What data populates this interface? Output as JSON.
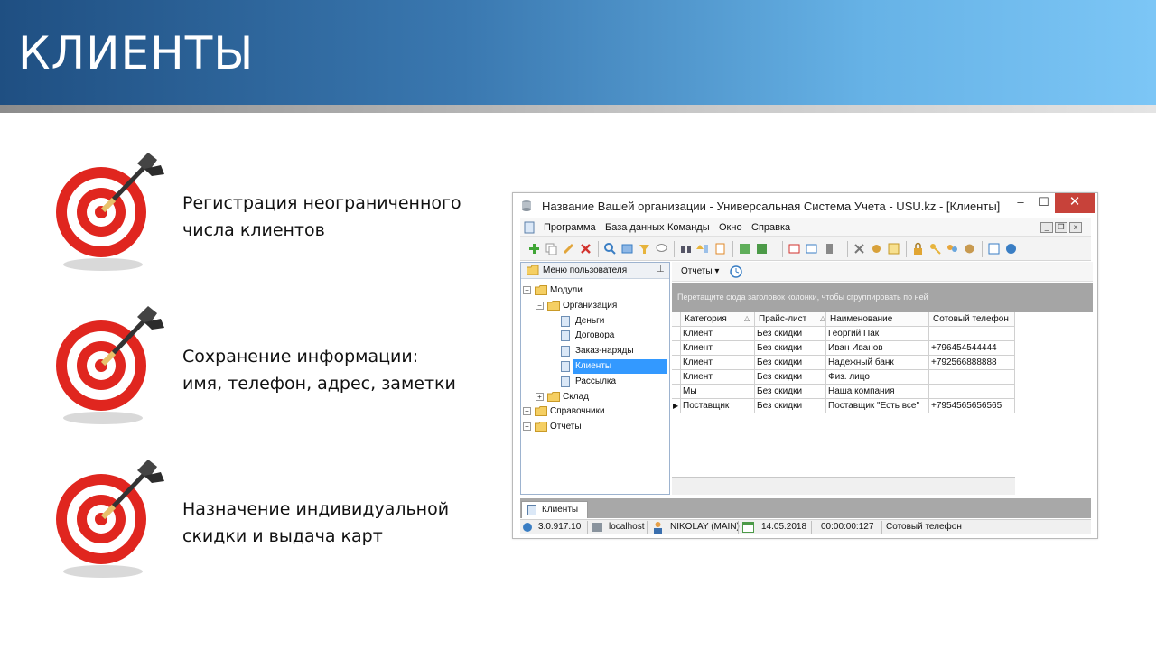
{
  "slide": {
    "title": "КЛИЕНТЫ",
    "features": [
      {
        "line1": "Регистрация неограниченного",
        "line2": "числа клиентов"
      },
      {
        "line1": "Сохранение информации:",
        "line2": "имя, телефон, адрес, заметки"
      },
      {
        "line1": "Назначение индивидуальной",
        "line2": "скидки и выдача карт"
      }
    ]
  },
  "window": {
    "title": "Название Вашей организации - Универсальная Система Учета - USU.kz - [Клиенты]",
    "controls": {
      "minimize": "–",
      "maximize": "☐",
      "close": "✕"
    },
    "menu": [
      "Программа",
      "База данных",
      "Команды",
      "Окно",
      "Справка"
    ],
    "mdi_controls": [
      "_",
      "❐",
      "x"
    ],
    "left_panel": {
      "title": "Меню пользователя",
      "tree": [
        {
          "label": "Модули",
          "level": 0,
          "type": "folder",
          "expander": "−"
        },
        {
          "label": "Организация",
          "level": 1,
          "type": "folder",
          "expander": "−"
        },
        {
          "label": "Деньги",
          "level": 2,
          "type": "doc"
        },
        {
          "label": "Договора",
          "level": 2,
          "type": "doc"
        },
        {
          "label": "Заказ-наряды",
          "level": 2,
          "type": "doc"
        },
        {
          "label": "Клиенты",
          "level": 2,
          "type": "doc",
          "selected": true
        },
        {
          "label": "Рассылка",
          "level": 2,
          "type": "doc"
        },
        {
          "label": "Склад",
          "level": 1,
          "type": "folder",
          "expander": "+"
        },
        {
          "label": "Справочники",
          "level": 0,
          "type": "folder",
          "expander": "+"
        },
        {
          "label": "Отчеты",
          "level": 0,
          "type": "folder",
          "expander": "+"
        }
      ]
    },
    "right_panel": {
      "reports_label": "Отчеты ▾",
      "group_hint": "Перетащите сюда заголовок колонки, чтобы сгруппировать по ней",
      "columns": [
        "Категория",
        "Прайс-лист",
        "Наименование",
        "Сотовый телефон"
      ],
      "rows": [
        [
          "Клиент",
          "Без скидки",
          "Георгий Пак",
          ""
        ],
        [
          "Клиент",
          "Без скидки",
          "Иван Иванов",
          "+796454544444"
        ],
        [
          "Клиент",
          "Без скидки",
          "Надежный банк",
          "+792566888888"
        ],
        [
          "Клиент",
          "Без скидки",
          "Физ. лицо",
          ""
        ],
        [
          "Мы",
          "Без скидки",
          "Наша компания",
          ""
        ],
        [
          "Поставщик",
          "Без скидки",
          "Поставщик \"Есть все\"",
          "+7954565656565"
        ]
      ],
      "current_row_marker": "▶"
    },
    "tab": "Клиенты",
    "status": {
      "version": "3.0.917.10",
      "server": "localhost",
      "user": "NIKOLAY (MAIN)",
      "date": "14.05.2018",
      "timer": "00:00:00:127",
      "field": "Сотовый телефон"
    }
  }
}
